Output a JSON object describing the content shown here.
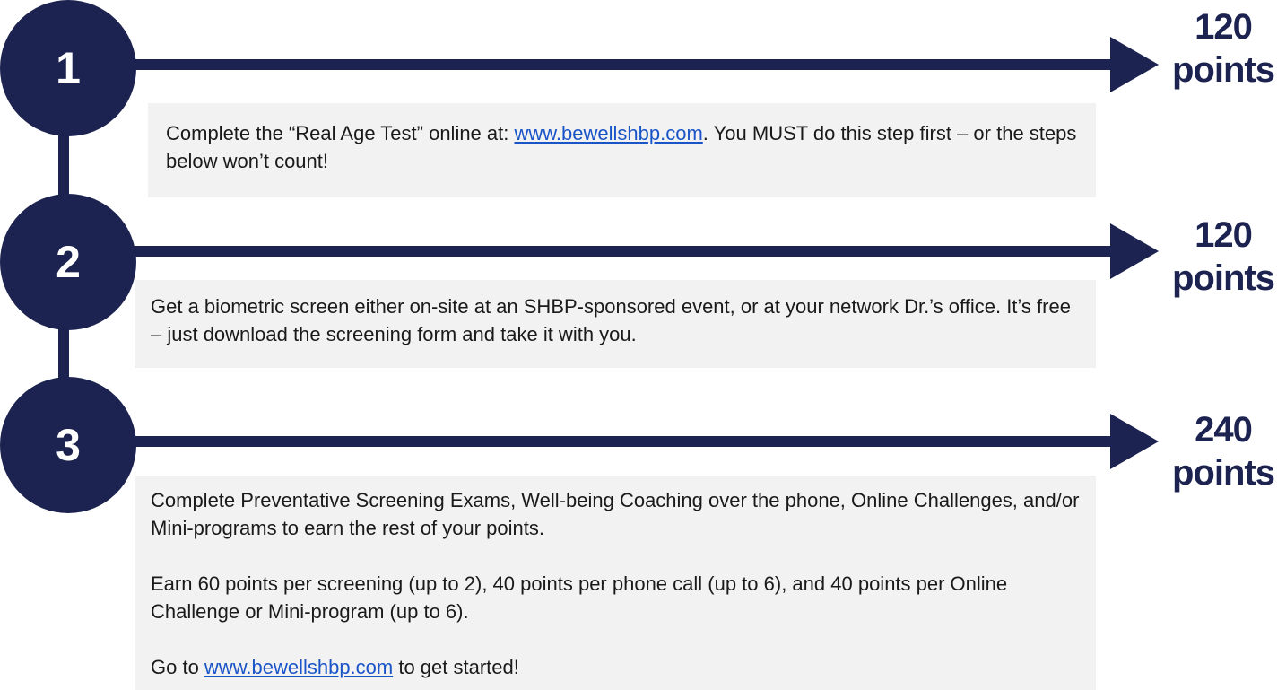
{
  "colors": {
    "navy": "#1c2350",
    "box": "#f2f2f2",
    "link": "#1a55c8"
  },
  "steps": [
    {
      "number": "1",
      "points_value": "120",
      "points_unit": "points",
      "text_before": "Complete the “Real Age Test” online at: ",
      "link": "www.bewellshbp.com",
      "text_after": ". You MUST do this step first – or the steps below won’t count!"
    },
    {
      "number": "2",
      "points_value": "120",
      "points_unit": "points",
      "text": "Get a biometric screen either on-site at an SHBP-sponsored event, or at your network Dr.’s office. It’s free – just download the screening form and take it with you."
    },
    {
      "number": "3",
      "points_value": "240",
      "points_unit": "points",
      "para1": "Complete Preventative Screening Exams, Well-being Coaching over the phone, Online Challenges, and/or Mini-programs to earn the rest of your points.",
      "para2": "Earn 60 points per screening (up to 2), 40 points per phone call (up to 6), and 40 points per Online Challenge or Mini-program (up to 6).",
      "para3_before": "Go to ",
      "link": "www.bewellshbp.com",
      "para3_after": " to get started!"
    }
  ]
}
